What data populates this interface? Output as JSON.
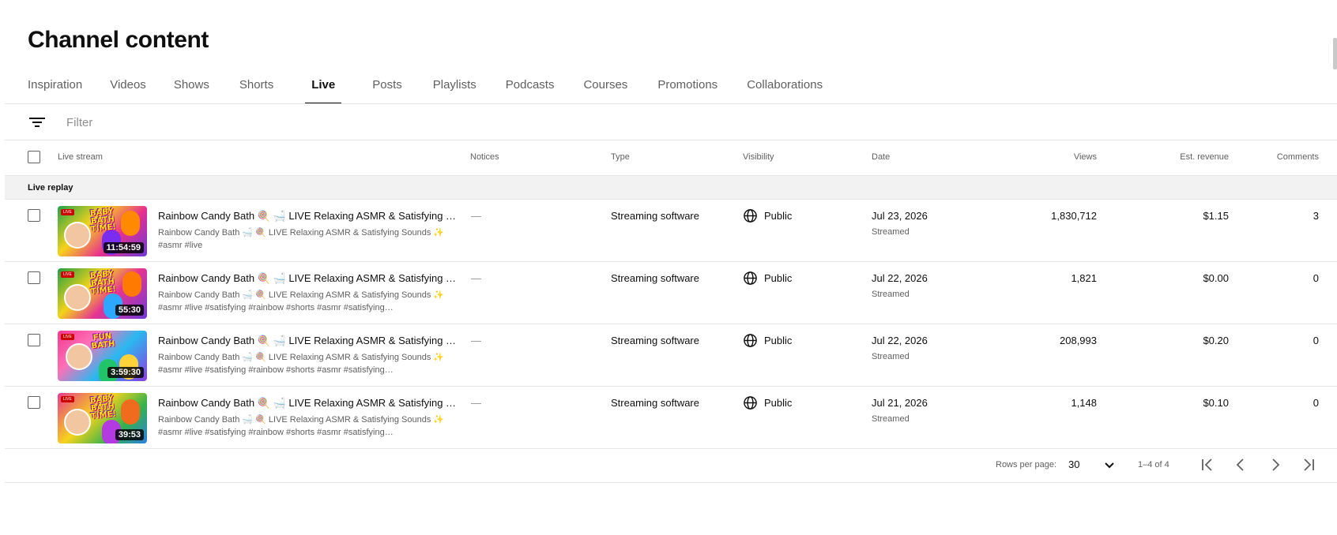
{
  "page": {
    "title": "Channel content"
  },
  "tabs": [
    {
      "label": "Inspiration",
      "active": false
    },
    {
      "label": "Videos",
      "active": false
    },
    {
      "label": "Shows",
      "active": false
    },
    {
      "label": "Shorts",
      "active": false
    },
    {
      "label": "Live",
      "active": true
    },
    {
      "label": "Posts",
      "active": false
    },
    {
      "label": "Playlists",
      "active": false
    },
    {
      "label": "Podcasts",
      "active": false
    },
    {
      "label": "Courses",
      "active": false
    },
    {
      "label": "Promotions",
      "active": false
    },
    {
      "label": "Collaborations",
      "active": false
    }
  ],
  "filter": {
    "placeholder": "Filter",
    "icon": "filter-lines-icon"
  },
  "table": {
    "headers": {
      "live_stream": "Live stream",
      "notices": "Notices",
      "type": "Type",
      "visibility": "Visibility",
      "date": "Date",
      "views": "Views",
      "revenue": "Est. revenue",
      "comments": "Comments"
    },
    "section_label": "Live replay",
    "rows": [
      {
        "title": "Rainbow Candy Bath 🍭 🛁 LIVE Relaxing ASMR & Satisfying Sounds ✨",
        "desc_line1": "Rainbow Candy Bath 🛁 🍭 LIVE Relaxing ASMR & Satisfying Sounds ✨",
        "desc_line2": "#asmr #live",
        "duration": "11:54:59",
        "thumb_words": "BABY BATH TIME!",
        "notices": "—",
        "type": "Streaming software",
        "visibility": "Public",
        "date": "Jul 23, 2026",
        "date_sub": "Streamed",
        "views": "1,830,712",
        "revenue": "$1.15",
        "comments": "3"
      },
      {
        "title": "Rainbow Candy Bath 🍭 🛁 LIVE Relaxing ASMR & Satisfying Sounds ✨",
        "desc_line1": "Rainbow Candy Bath 🛁 🍭 LIVE Relaxing ASMR & Satisfying Sounds ✨",
        "desc_line2": "#asmr #live #satisfying #rainbow #shorts #asmr #satisfying…",
        "duration": "55:30",
        "thumb_words": "BABY BATH TIME!",
        "notices": "—",
        "type": "Streaming software",
        "visibility": "Public",
        "date": "Jul 22, 2026",
        "date_sub": "Streamed",
        "views": "1,821",
        "revenue": "$0.00",
        "comments": "0"
      },
      {
        "title": "Rainbow Candy Bath 🍭 🛁 LIVE Relaxing ASMR & Satisfying Sounds ✨",
        "desc_line1": "Rainbow Candy Bath 🛁 🍭 LIVE Relaxing ASMR & Satisfying Sounds ✨",
        "desc_line2": "#asmr #live #satisfying #rainbow #shorts #asmr #satisfying…",
        "duration": "3:59:30",
        "thumb_words": "FUN BATH",
        "notices": "—",
        "type": "Streaming software",
        "visibility": "Public",
        "date": "Jul 22, 2026",
        "date_sub": "Streamed",
        "views": "208,993",
        "revenue": "$0.20",
        "comments": "0"
      },
      {
        "title": "Rainbow Candy Bath 🍭 🛁 LIVE Relaxing ASMR & Satisfying Sounds ✨",
        "desc_line1": "Rainbow Candy Bath 🛁 🍭 LIVE Relaxing ASMR & Satisfying Sounds ✨",
        "desc_line2": "#asmr #live #satisfying #rainbow #shorts #asmr #satisfying…",
        "duration": "39:53",
        "thumb_words": "BABY BATH TIME!",
        "notices": "—",
        "type": "Streaming software",
        "visibility": "Public",
        "date": "Jul 21, 2026",
        "date_sub": "Streamed",
        "views": "1,148",
        "revenue": "$0.10",
        "comments": "0"
      }
    ]
  },
  "pagination": {
    "rows_per_page_label": "Rows per page:",
    "rows_per_page_value": "30",
    "range": "1–4 of 4"
  },
  "colors": {
    "text_primary": "#0f0f0f",
    "text_secondary": "#606060",
    "divider": "#e5e5e5",
    "section_bg": "#f2f2f2"
  }
}
